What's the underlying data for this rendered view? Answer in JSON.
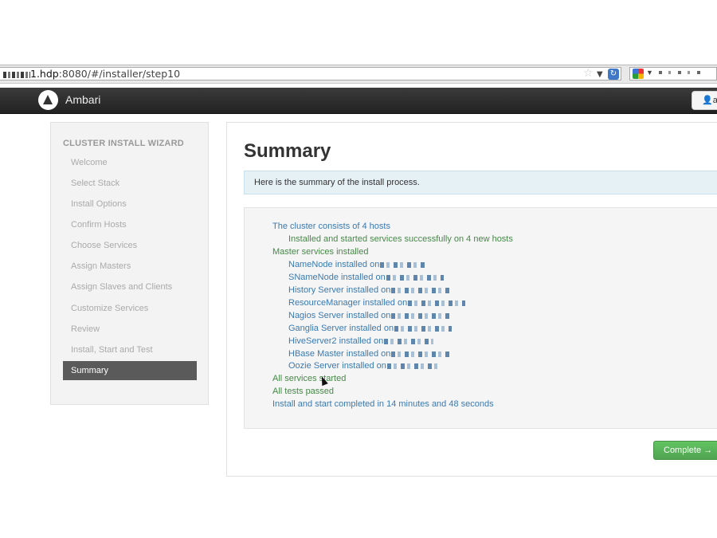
{
  "browser": {
    "url_visible": "1.hdp:8080/#/installer/step10",
    "url_host": "1.hdp",
    "url_rest": ":8080/#/installer/step10"
  },
  "navbar": {
    "brand": "Ambari",
    "user_label": "a"
  },
  "sidebar": {
    "header": "CLUSTER INSTALL WIZARD",
    "steps": [
      "Welcome",
      "Select Stack",
      "Install Options",
      "Confirm Hosts",
      "Choose Services",
      "Assign Masters",
      "Assign Slaves and Clients",
      "Customize Services",
      "Review",
      "Install, Start and Test"
    ],
    "active_step": "Summary"
  },
  "main": {
    "title": "Summary",
    "info": "Here is the summary of the install process.",
    "summary": {
      "cluster_hosts": "The cluster consists of 4 hosts",
      "installed_started": "Installed and started services successfully on 4 new hosts",
      "master_services": "Master services installed",
      "services": [
        "NameNode installed on",
        "SNameNode installed on",
        "History Server installed on",
        "ResourceManager installed on",
        "Nagios Server installed on",
        "Ganglia Server installed on",
        "HiveServer2 installed on",
        "HBase Master installed on",
        "Oozie Server installed on"
      ],
      "all_started": "All services started",
      "all_tests": "All tests passed",
      "completed": "Install and start completed in 14 minutes and 48 seconds"
    },
    "complete_button": "Complete →"
  },
  "colors": {
    "navbar": "#2b2b2b",
    "link_blue": "#3a7ab0",
    "success_green": "#468847",
    "button_green": "#5bb75b",
    "active_step": "#5a5a5a"
  }
}
